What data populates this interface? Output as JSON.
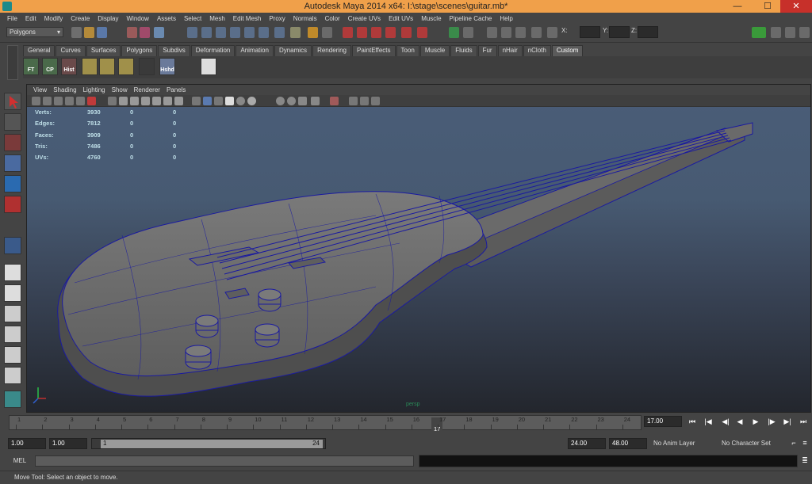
{
  "window": {
    "title": "Autodesk Maya 2014 x64: I:\\stage\\scenes\\guitar.mb*",
    "min": "—",
    "max": "☐",
    "close": "✕"
  },
  "menu": [
    "File",
    "Edit",
    "Modify",
    "Create",
    "Display",
    "Window",
    "Assets",
    "Select",
    "Mesh",
    "Edit Mesh",
    "Proxy",
    "Normals",
    "Color",
    "Create UVs",
    "Edit UVs",
    "Muscle",
    "Pipeline Cache",
    "Help"
  ],
  "status": {
    "mode": "Polygons",
    "x_label": "X:",
    "y_label": "Y:",
    "z_label": "Z:"
  },
  "shelf": {
    "tabs": [
      "General",
      "Curves",
      "Surfaces",
      "Polygons",
      "Subdivs",
      "Deformation",
      "Animation",
      "Dynamics",
      "Rendering",
      "PaintEffects",
      "Toon",
      "Muscle",
      "Fluids",
      "Fur",
      "nHair",
      "nCloth",
      "Custom"
    ],
    "active_tab": "Custom",
    "buttons": [
      "FT",
      "CP",
      "Hist",
      "",
      "",
      "",
      "",
      "Hshd",
      ""
    ]
  },
  "viewport": {
    "menu": [
      "View",
      "Shading",
      "Lighting",
      "Show",
      "Renderer",
      "Panels"
    ],
    "hud": [
      {
        "label": "Verts:",
        "a": "3930",
        "b": "0",
        "c": "0"
      },
      {
        "label": "Edges:",
        "a": "7812",
        "b": "0",
        "c": "0"
      },
      {
        "label": "Faces:",
        "a": "3909",
        "b": "0",
        "c": "0"
      },
      {
        "label": "Tris:",
        "a": "7486",
        "b": "0",
        "c": "0"
      },
      {
        "label": "UVs:",
        "a": "4760",
        "b": "0",
        "c": "0"
      }
    ],
    "camera": "persp"
  },
  "timeline": {
    "ticks": [
      "1",
      "2",
      "3",
      "4",
      "5",
      "6",
      "7",
      "8",
      "9",
      "10",
      "11",
      "12",
      "13",
      "14",
      "15",
      "16",
      "17",
      "18",
      "19",
      "20",
      "21",
      "22",
      "23",
      "24"
    ],
    "current_frame": "17",
    "current_time": "17.00"
  },
  "range": {
    "start": "1.00",
    "start2": "1.00",
    "range_start": "1",
    "range_end": "24",
    "end": "24.00",
    "end2": "48.00",
    "anim_layer": "No Anim Layer",
    "character_set": "No Character Set"
  },
  "mel": {
    "label": "MEL"
  },
  "help": {
    "text": "Move Tool: Select an object to move."
  },
  "colors": {
    "title_bar": "#f0a04a",
    "ui_bg": "#444444",
    "wire": "#1a1aa0",
    "mesh": "#6a6a6a"
  }
}
